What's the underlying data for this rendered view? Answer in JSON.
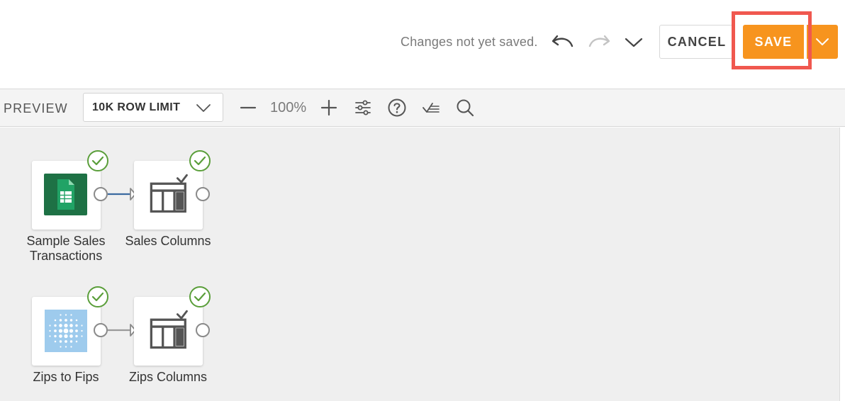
{
  "header": {
    "status_text": "Changes not yet saved.",
    "undo_icon": "undo-icon",
    "redo_icon": "redo-icon",
    "more_icon": "chevron-down-icon",
    "cancel_label": "CANCEL",
    "save_label": "SAVE",
    "save_menu_icon": "chevron-down-icon"
  },
  "toolbar": {
    "preview_label": "PREVIEW",
    "row_limit": "10K ROW LIMIT",
    "zoom_level": "100%",
    "icons": [
      "zoom-out-icon",
      "zoom-in-icon",
      "settings-sliders-icon",
      "help-icon",
      "validate-icon",
      "search-icon"
    ]
  },
  "canvas": {
    "nodes": [
      {
        "label_line1": "Sample Sales",
        "label_line2": "Transactions",
        "icon": "google-sheets-icon",
        "status": "check-icon"
      },
      {
        "label": "Sales Columns",
        "icon": "select-columns-icon",
        "status": "check-icon"
      },
      {
        "label": "Zips to Fips",
        "icon": "dataset-icon",
        "status": "check-icon"
      },
      {
        "label": "Zips Columns",
        "icon": "select-columns-icon",
        "status": "check-icon"
      }
    ]
  },
  "colors": {
    "accent": "#f7941e",
    "highlight": "#f0584f",
    "success": "#5a9e3a",
    "sheets_green": "#1e7145",
    "dataset_blue": "#9ecbed",
    "link_blue": "#3b6aa0"
  }
}
